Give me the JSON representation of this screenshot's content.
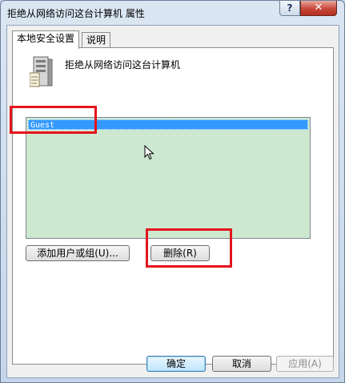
{
  "window": {
    "title": "拒绝从网络访问这台计算机 属性",
    "help_glyph": "?",
    "close_glyph": "✕"
  },
  "tabs": [
    {
      "label": "本地安全设置",
      "active": true
    },
    {
      "label": "说明",
      "active": false
    }
  ],
  "policy": {
    "title": "拒绝从网络访问这台计算机",
    "icon": "server-icon"
  },
  "list": {
    "items": [
      "Guest"
    ],
    "selected_index": 0
  },
  "buttons": {
    "add": "添加用户或组(U)...",
    "remove": "删除(R)",
    "ok": "确定",
    "cancel": "取消",
    "apply": "应用(A)"
  },
  "colors": {
    "list_background": "#cce8d1",
    "selection": "#3399ff",
    "highlight_box": "#e4141c"
  }
}
